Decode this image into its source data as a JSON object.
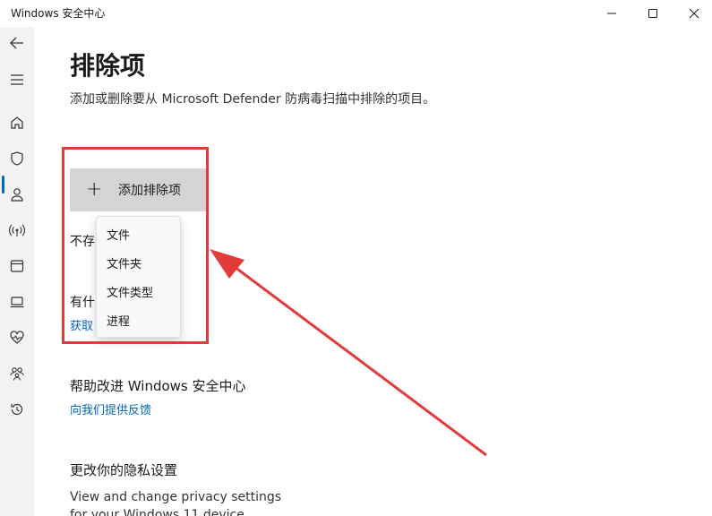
{
  "window": {
    "title": "Windows 安全中心",
    "controls": [
      "minimize",
      "maximize",
      "close"
    ]
  },
  "sidebar": {
    "items": [
      {
        "icon": "back-arrow-icon"
      },
      {
        "icon": "hamburger-menu-icon"
      },
      {
        "icon": "home-icon"
      },
      {
        "icon": "shield-icon",
        "active": true
      },
      {
        "icon": "person-icon"
      },
      {
        "icon": "wifi-antenna-icon"
      },
      {
        "icon": "app-browser-icon"
      },
      {
        "icon": "laptop-icon"
      },
      {
        "icon": "heart-pulse-icon"
      },
      {
        "icon": "family-icon"
      },
      {
        "icon": "history-icon"
      }
    ],
    "accent": "#0067c0"
  },
  "main": {
    "title": "排除项",
    "description": "添加或删除要从 Microsoft Defender 防病毒扫描中排除的项目。",
    "add_button_label": "添加排除项",
    "no_exclusions_text": "不存",
    "question_text": "有什",
    "get_help_link": "获取"
  },
  "dropdown": {
    "items": [
      "文件",
      "文件夹",
      "文件类型",
      "进程"
    ]
  },
  "sections": {
    "improve_title": "帮助改进 Windows 安全中心",
    "feedback_link": "向我们提供反馈",
    "privacy_title": "更改你的隐私设置",
    "privacy_line1": "View and change privacy settings",
    "privacy_line2": "for your Windows 11 device."
  },
  "annotation": {
    "highlight_color": "#e23b3b"
  }
}
